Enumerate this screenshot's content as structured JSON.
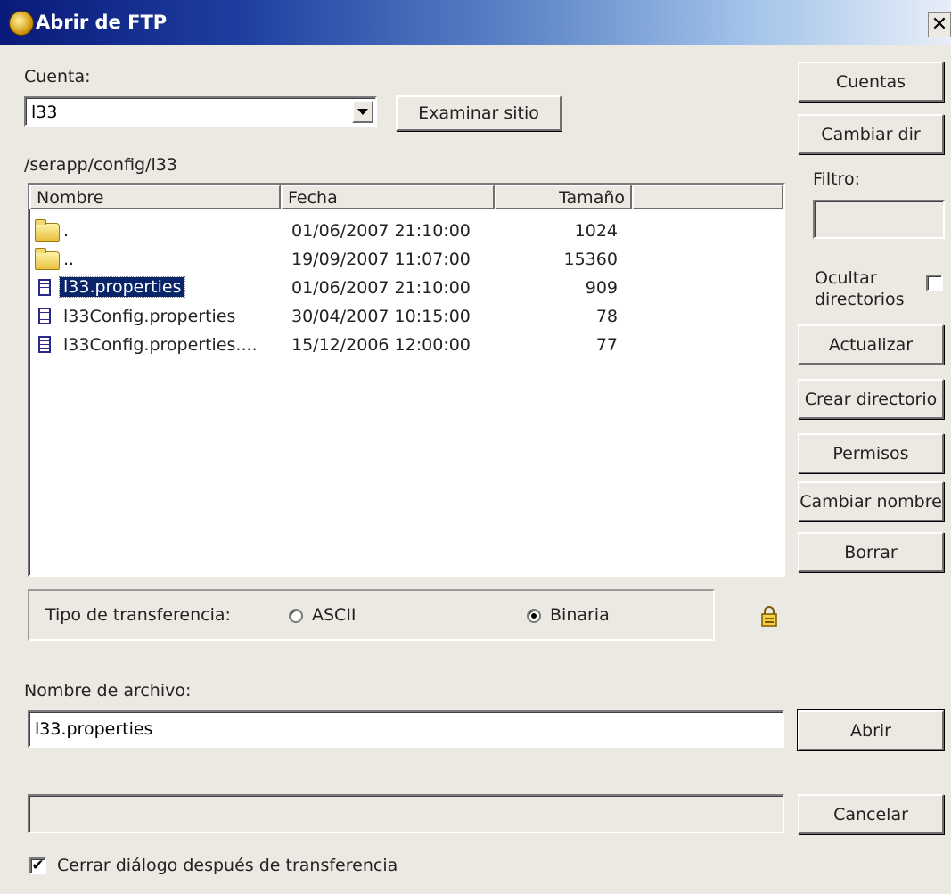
{
  "window": {
    "title": "Abrir de FTP",
    "close_glyph": "✕"
  },
  "account": {
    "label": "Cuenta:",
    "selected": "l33",
    "browse_button": "Examinar sitio"
  },
  "current_path": "/serapp/config/l33",
  "file_list": {
    "columns": [
      "Nombre",
      "Fecha",
      "Tamaño"
    ],
    "rows": [
      {
        "type": "folder",
        "name": ".",
        "date": "01/06/2007  21:10:00",
        "size": "1024"
      },
      {
        "type": "folder",
        "name": "..",
        "date": "19/09/2007  11:07:00",
        "size": "15360"
      },
      {
        "type": "file",
        "name": "l33.properties",
        "date": "01/06/2007  21:10:00",
        "size": "909",
        "selected": true
      },
      {
        "type": "file",
        "name": "l33Config.properties",
        "date": "30/04/2007  10:15:00",
        "size": "78"
      },
      {
        "type": "file",
        "name": "l33Config.properties....",
        "date": "15/12/2006  12:00:00",
        "size": "77"
      }
    ]
  },
  "sidebar": {
    "accounts_button": "Cuentas",
    "change_dir_button": "Cambiar dir",
    "filter_label": "Filtro:",
    "filter_value": "",
    "hide_dirs_label_1": "Ocultar",
    "hide_dirs_label_2": "directorios",
    "hide_dirs_checked": false,
    "refresh_button": "Actualizar",
    "create_dir_button": "Crear directorio",
    "permissions_button": "Permisos",
    "rename_button": "Cambiar nombre",
    "delete_button": "Borrar"
  },
  "transfer": {
    "label": "Tipo de transferencia:",
    "ascii_label": "ASCII",
    "binary_label": "Binaria",
    "selected": "Binaria"
  },
  "filename": {
    "label": "Nombre de archivo:",
    "value": "l33.properties"
  },
  "actions": {
    "open_button": "Abrir",
    "cancel_button": "Cancelar"
  },
  "close_after_transfer": {
    "label": "Cerrar diálogo después de transferencia",
    "checked": true,
    "check_glyph": "✔"
  }
}
